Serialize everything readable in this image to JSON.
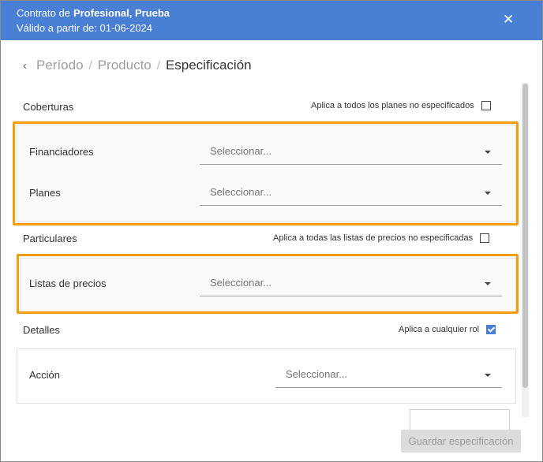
{
  "header": {
    "contract_prefix": "Contrato de",
    "contract_name": "Profesional, Prueba",
    "valid_from": "Válido a partir de: 01-06-2024",
    "close_glyph": "✕",
    "background_color": "#4a7fd6"
  },
  "breadcrumb": {
    "back_glyph": "‹",
    "items": [
      "Período",
      "Producto",
      "Especificación"
    ],
    "separator": "/"
  },
  "coberturas": {
    "title": "Coberturas",
    "apply_label": "Aplica a todos los planes no especificados",
    "apply_checked": false,
    "fields": [
      {
        "label": "Financiadores",
        "placeholder": "Seleccionar..."
      },
      {
        "label": "Planes",
        "placeholder": "Seleccionar..."
      }
    ]
  },
  "particulares": {
    "title": "Particulares",
    "apply_label": "Aplica a todas las listas de precios no especificadas",
    "apply_checked": false,
    "fields": [
      {
        "label": "Listas de precios",
        "placeholder": "Seleccionar..."
      }
    ]
  },
  "detalles": {
    "title": "Detalles",
    "apply_label": "Aplica a cualquier rol",
    "apply_checked": true,
    "fields": [
      {
        "label": "Acción",
        "placeholder": "Seleccionar..."
      }
    ]
  },
  "footer": {
    "save_label": "Guardar especificación"
  },
  "colors": {
    "accent": "#4a7fd6",
    "highlight": "#f59d0c",
    "disabled_button": "#dcdcdc"
  },
  "icons": [
    "close-icon",
    "chevron-left-icon",
    "caret-down-icon",
    "checkbox-icon"
  ]
}
